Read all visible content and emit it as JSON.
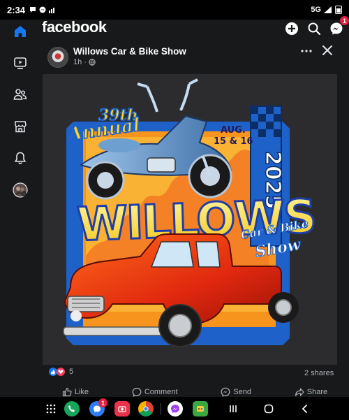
{
  "status_bar": {
    "time": "2:34",
    "network": "5G"
  },
  "app": {
    "name": "facebook",
    "messenger_badge": "1"
  },
  "post": {
    "page_name": "Willows Car & Bike Show",
    "time": "1h",
    "reaction_count": "5",
    "shares": "2 shares",
    "actions": {
      "like": "Like",
      "comment": "Comment",
      "send": "Send",
      "share": "Share"
    }
  },
  "flyer": {
    "edition": "39th",
    "annual": "Annual",
    "date_month": "AUG.",
    "date_days": "15 & 16",
    "year": "2025",
    "title": "WILLOWS",
    "subtitle_1": "Car & Bike",
    "subtitle_2": "Show"
  },
  "dock": {
    "app_badge": "1"
  },
  "colors": {
    "background": "#18191a",
    "text": "#e4e6eb",
    "muted": "#b0b3b8",
    "fb_blue": "#1877f2",
    "badge_red": "#e41e3f",
    "flyer_orange": "#f7941d",
    "flyer_yellow": "#f5e11b",
    "flyer_blue": "#1e62c9"
  }
}
